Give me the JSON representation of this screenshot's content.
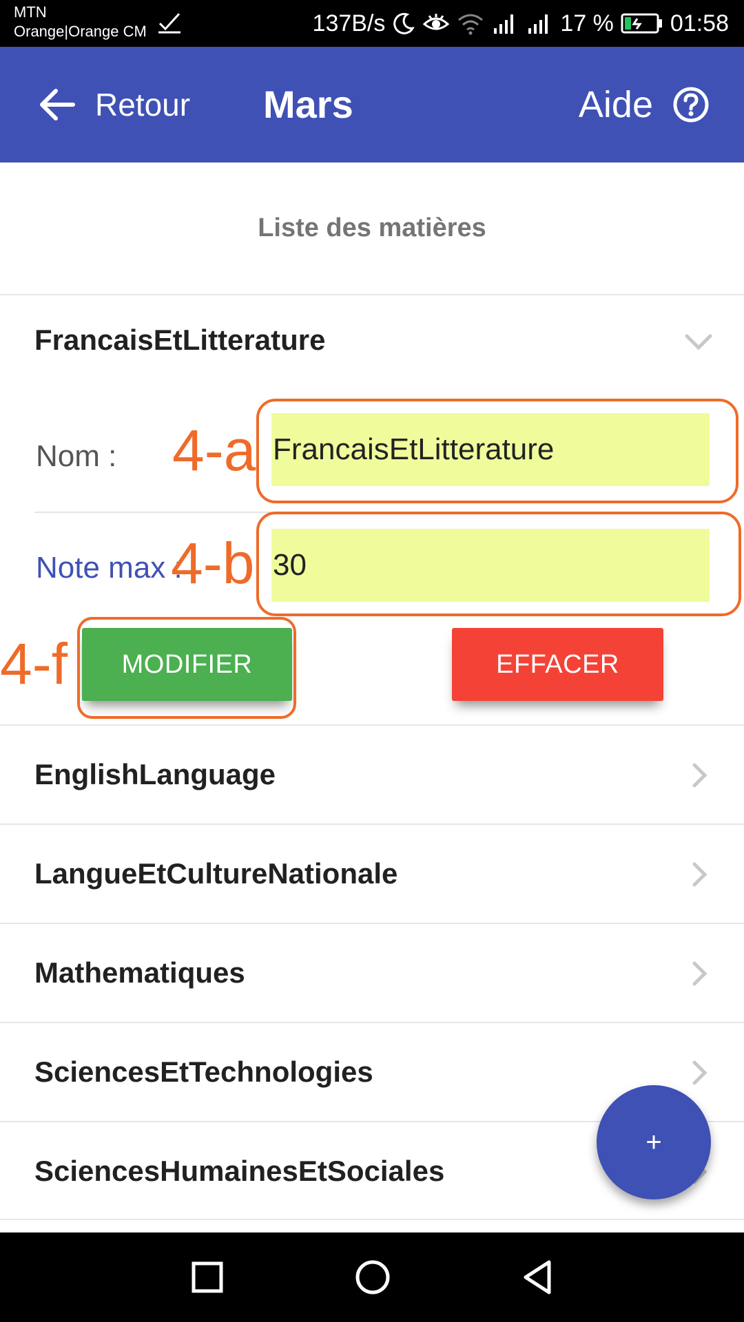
{
  "status_bar": {
    "carrier_1": "MTN",
    "carrier_2": "Orange|Orange CM",
    "speed": "137B/s",
    "battery_percent": "17 %",
    "time": "01:58"
  },
  "app_bar": {
    "back_label": "Retour",
    "title": "Mars",
    "help_label": "Aide",
    "color": "#3F51B5"
  },
  "list_header": "Liste des matières",
  "expanded_subject": {
    "title": "FrancaisEtLitterature",
    "name_label": "Nom :",
    "name_value": "FrancaisEtLitterature",
    "max_label": "Note max :",
    "max_value": "30",
    "modify_label": "MODIFIER",
    "erase_label": "EFFACER",
    "input_bg": "#F0FC9C"
  },
  "subjects": [
    {
      "label": "EnglishLanguage"
    },
    {
      "label": "LangueEtCultureNationale"
    },
    {
      "label": "Mathematiques"
    },
    {
      "label": "SciencesEtTechnologies"
    },
    {
      "label": "SciencesHumainesEtSociales"
    }
  ],
  "annotations": {
    "a": "4-a",
    "b": "4-b",
    "f": "4-f",
    "color": "#EE6B2A"
  },
  "fab_label": "+",
  "icons": {
    "back": "arrow-left-icon",
    "help": "help-circle-icon",
    "expand": "chevron-down-icon",
    "item": "chevron-right-icon",
    "nav_recent": "square-icon",
    "nav_home": "circle-icon",
    "nav_back": "triangle-back-icon"
  }
}
